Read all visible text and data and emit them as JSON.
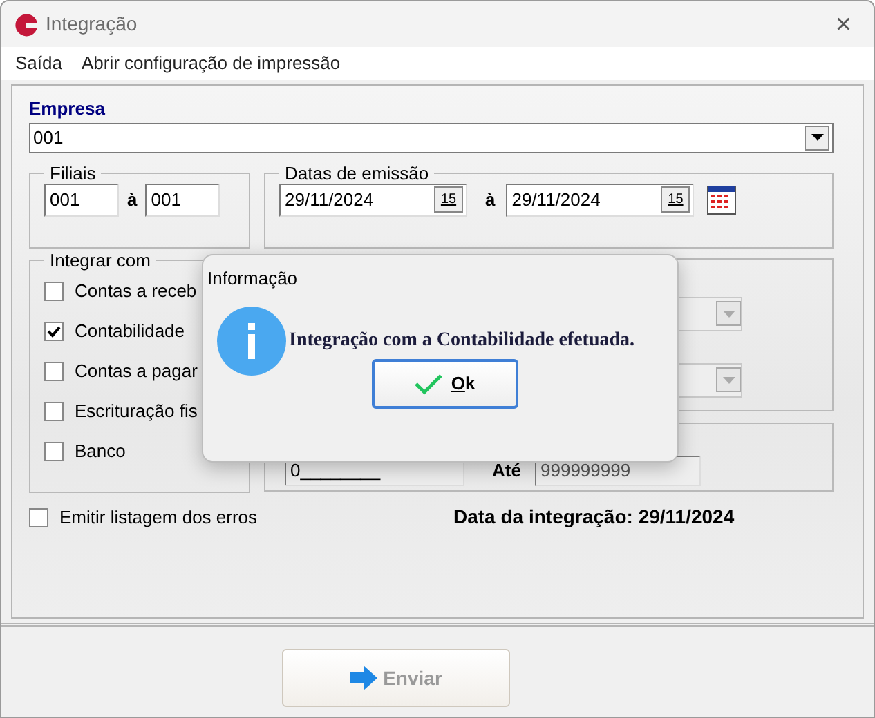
{
  "window": {
    "title": "Integração",
    "close": "×"
  },
  "menu": [
    {
      "label": "Saída"
    },
    {
      "label": "Abrir configuração de impressão"
    }
  ],
  "empresa": {
    "label": "Empresa",
    "value": "001"
  },
  "filiais": {
    "legend": "Filiais",
    "from": "001",
    "separator": "à",
    "to": "001"
  },
  "datas": {
    "legend": "Datas de emissão",
    "from": "29/11/2024",
    "from_button": "15",
    "separator": "à",
    "to": "29/11/2024",
    "to_button": "15"
  },
  "integrar": {
    "legend": "Integrar com",
    "options": [
      {
        "label": "Contas a receb",
        "checked": false
      },
      {
        "label": "Contabilidade",
        "checked": true
      },
      {
        "label": "Contas a pagar",
        "checked": false
      },
      {
        "label": "Escrituração fis",
        "checked": false
      },
      {
        "label": "Banco",
        "checked": false
      }
    ]
  },
  "range": {
    "from": "0________",
    "to_label": "Até",
    "to": "999999999"
  },
  "emitir": {
    "label": "Emitir listagem dos erros",
    "checked": false
  },
  "data_integracao": {
    "label": "Data da integração:",
    "value": "29/11/2024"
  },
  "send_button": {
    "label": "Enviar",
    "disabled": true
  },
  "dialog": {
    "title": "Informação",
    "message": "Integração com a Contabilidade efetuada.",
    "button": "Ok"
  }
}
